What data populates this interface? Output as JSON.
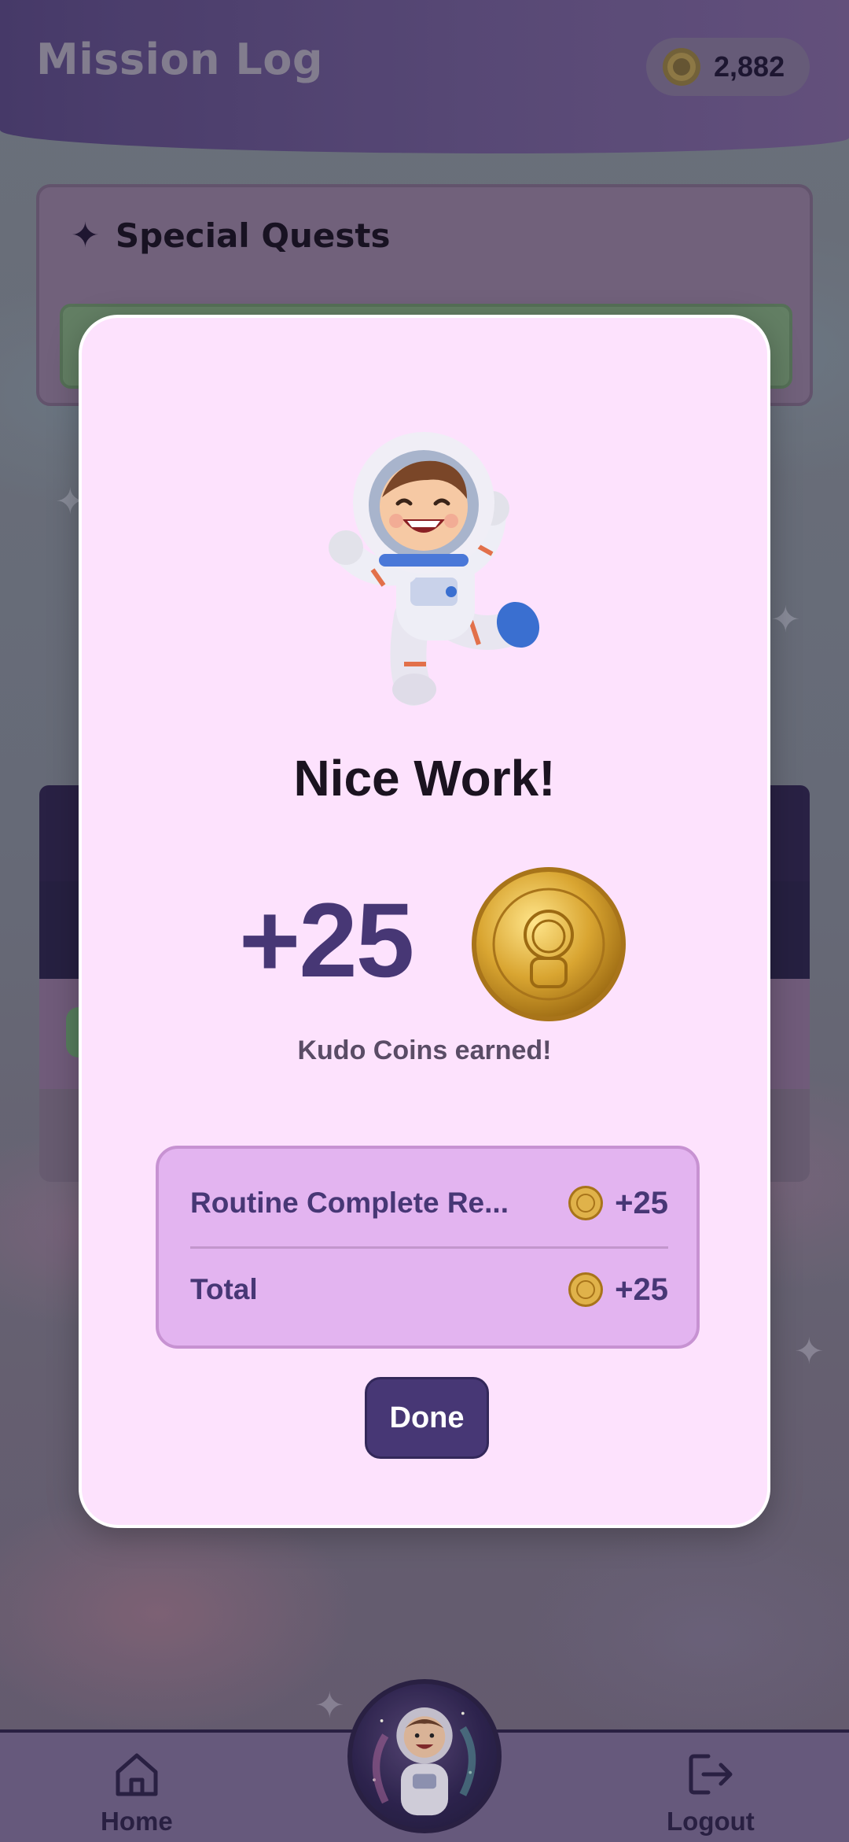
{
  "header": {
    "title": "Mission Log",
    "coin_balance": "2,882",
    "coin_icon": "coin-icon"
  },
  "quests": {
    "title": "Special Quests",
    "icon": "sparkle-icon"
  },
  "nav": {
    "home_label": "Home",
    "logout_label": "Logout",
    "home_icon": "home-icon",
    "logout_icon": "logout-icon",
    "avatar": "astronaut-avatar"
  },
  "modal": {
    "title": "Nice Work!",
    "amount": "+25",
    "subtitle": "Kudo Coins earned!",
    "breakdown": [
      {
        "label": "Routine Complete Re...",
        "value": "+25"
      },
      {
        "label": "Total",
        "value": "+25"
      }
    ],
    "done_label": "Done"
  },
  "colors": {
    "modal_bg": "#fde2fd",
    "accent": "#473775",
    "breakdown_bg": "#e3b4f0",
    "coin_gold": "#d8a83a"
  }
}
